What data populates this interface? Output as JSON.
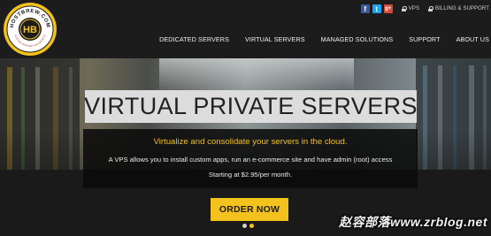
{
  "brand": {
    "logo_initials": "HB",
    "logo_ring_text": "HOSTBREW.COM",
    "logo_tagline": "HOSTING PARTNER FOR GROWTH"
  },
  "topbar": {
    "social": [
      {
        "icon": "facebook-icon",
        "glyph": "f"
      },
      {
        "icon": "twitter-icon",
        "glyph": "t"
      },
      {
        "icon": "google-plus-icon",
        "glyph": "g+"
      }
    ],
    "vps_label": "VPS",
    "billing_label": "BILLING & SUPPORT"
  },
  "nav": {
    "items": [
      "DEDICATED SERVERS",
      "VIRTUAL SERVERS",
      "MANAGED SOLUTIONS",
      "SUPPORT",
      "ABOUT US"
    ]
  },
  "hero": {
    "title": "VIRTUAL PRIVATE SERVERS",
    "subtitle": "Virtualize and consolidate your servers in the cloud.",
    "description": "A VPS allows you to install custom apps, run an e-commerce site and have admin (root) access",
    "price": "Starting at $2.95/per month.",
    "cta_label": "ORDER NOW",
    "slider": {
      "total": 2,
      "active": 2
    }
  },
  "watermark": "赵容部落www.zrblog.net",
  "colors": {
    "accent": "#f4c21d",
    "header_bg": "#1c1c1c",
    "title_box_bg": "#dcdcdc"
  }
}
